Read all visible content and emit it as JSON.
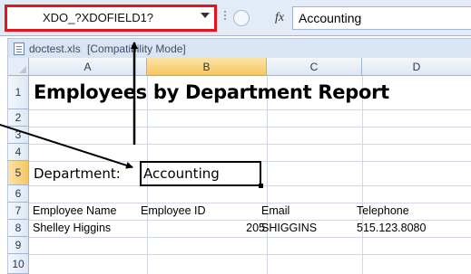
{
  "formula_bar": {
    "name_box_value": "XDO_?XDOFIELD1?",
    "fx_label": "fx",
    "formula_value": "Accounting"
  },
  "workbook": {
    "filename": "doctest.xls",
    "mode": "[Compatibility Mode]"
  },
  "grid": {
    "columns": [
      "A",
      "B",
      "C",
      "D"
    ],
    "rows": [
      "1",
      "2",
      "3",
      "4",
      "5",
      "6",
      "7",
      "8",
      "9",
      "10"
    ],
    "selected_column": "B",
    "selected_row": "5"
  },
  "report": {
    "title": "Employees by Department Report",
    "department_label": "Department:",
    "department_value": "Accounting",
    "headers": [
      "Employee Name",
      "Employee ID",
      "Email",
      "Telephone"
    ],
    "rows": [
      {
        "name": "Shelley Higgins",
        "id": "205",
        "email": "SHIGGINS",
        "phone": "515.123.8080"
      }
    ]
  },
  "colors": {
    "highlight_border": "#e8141b",
    "selected_header": "#f6c760",
    "grid_line": "#d0d7e5"
  }
}
